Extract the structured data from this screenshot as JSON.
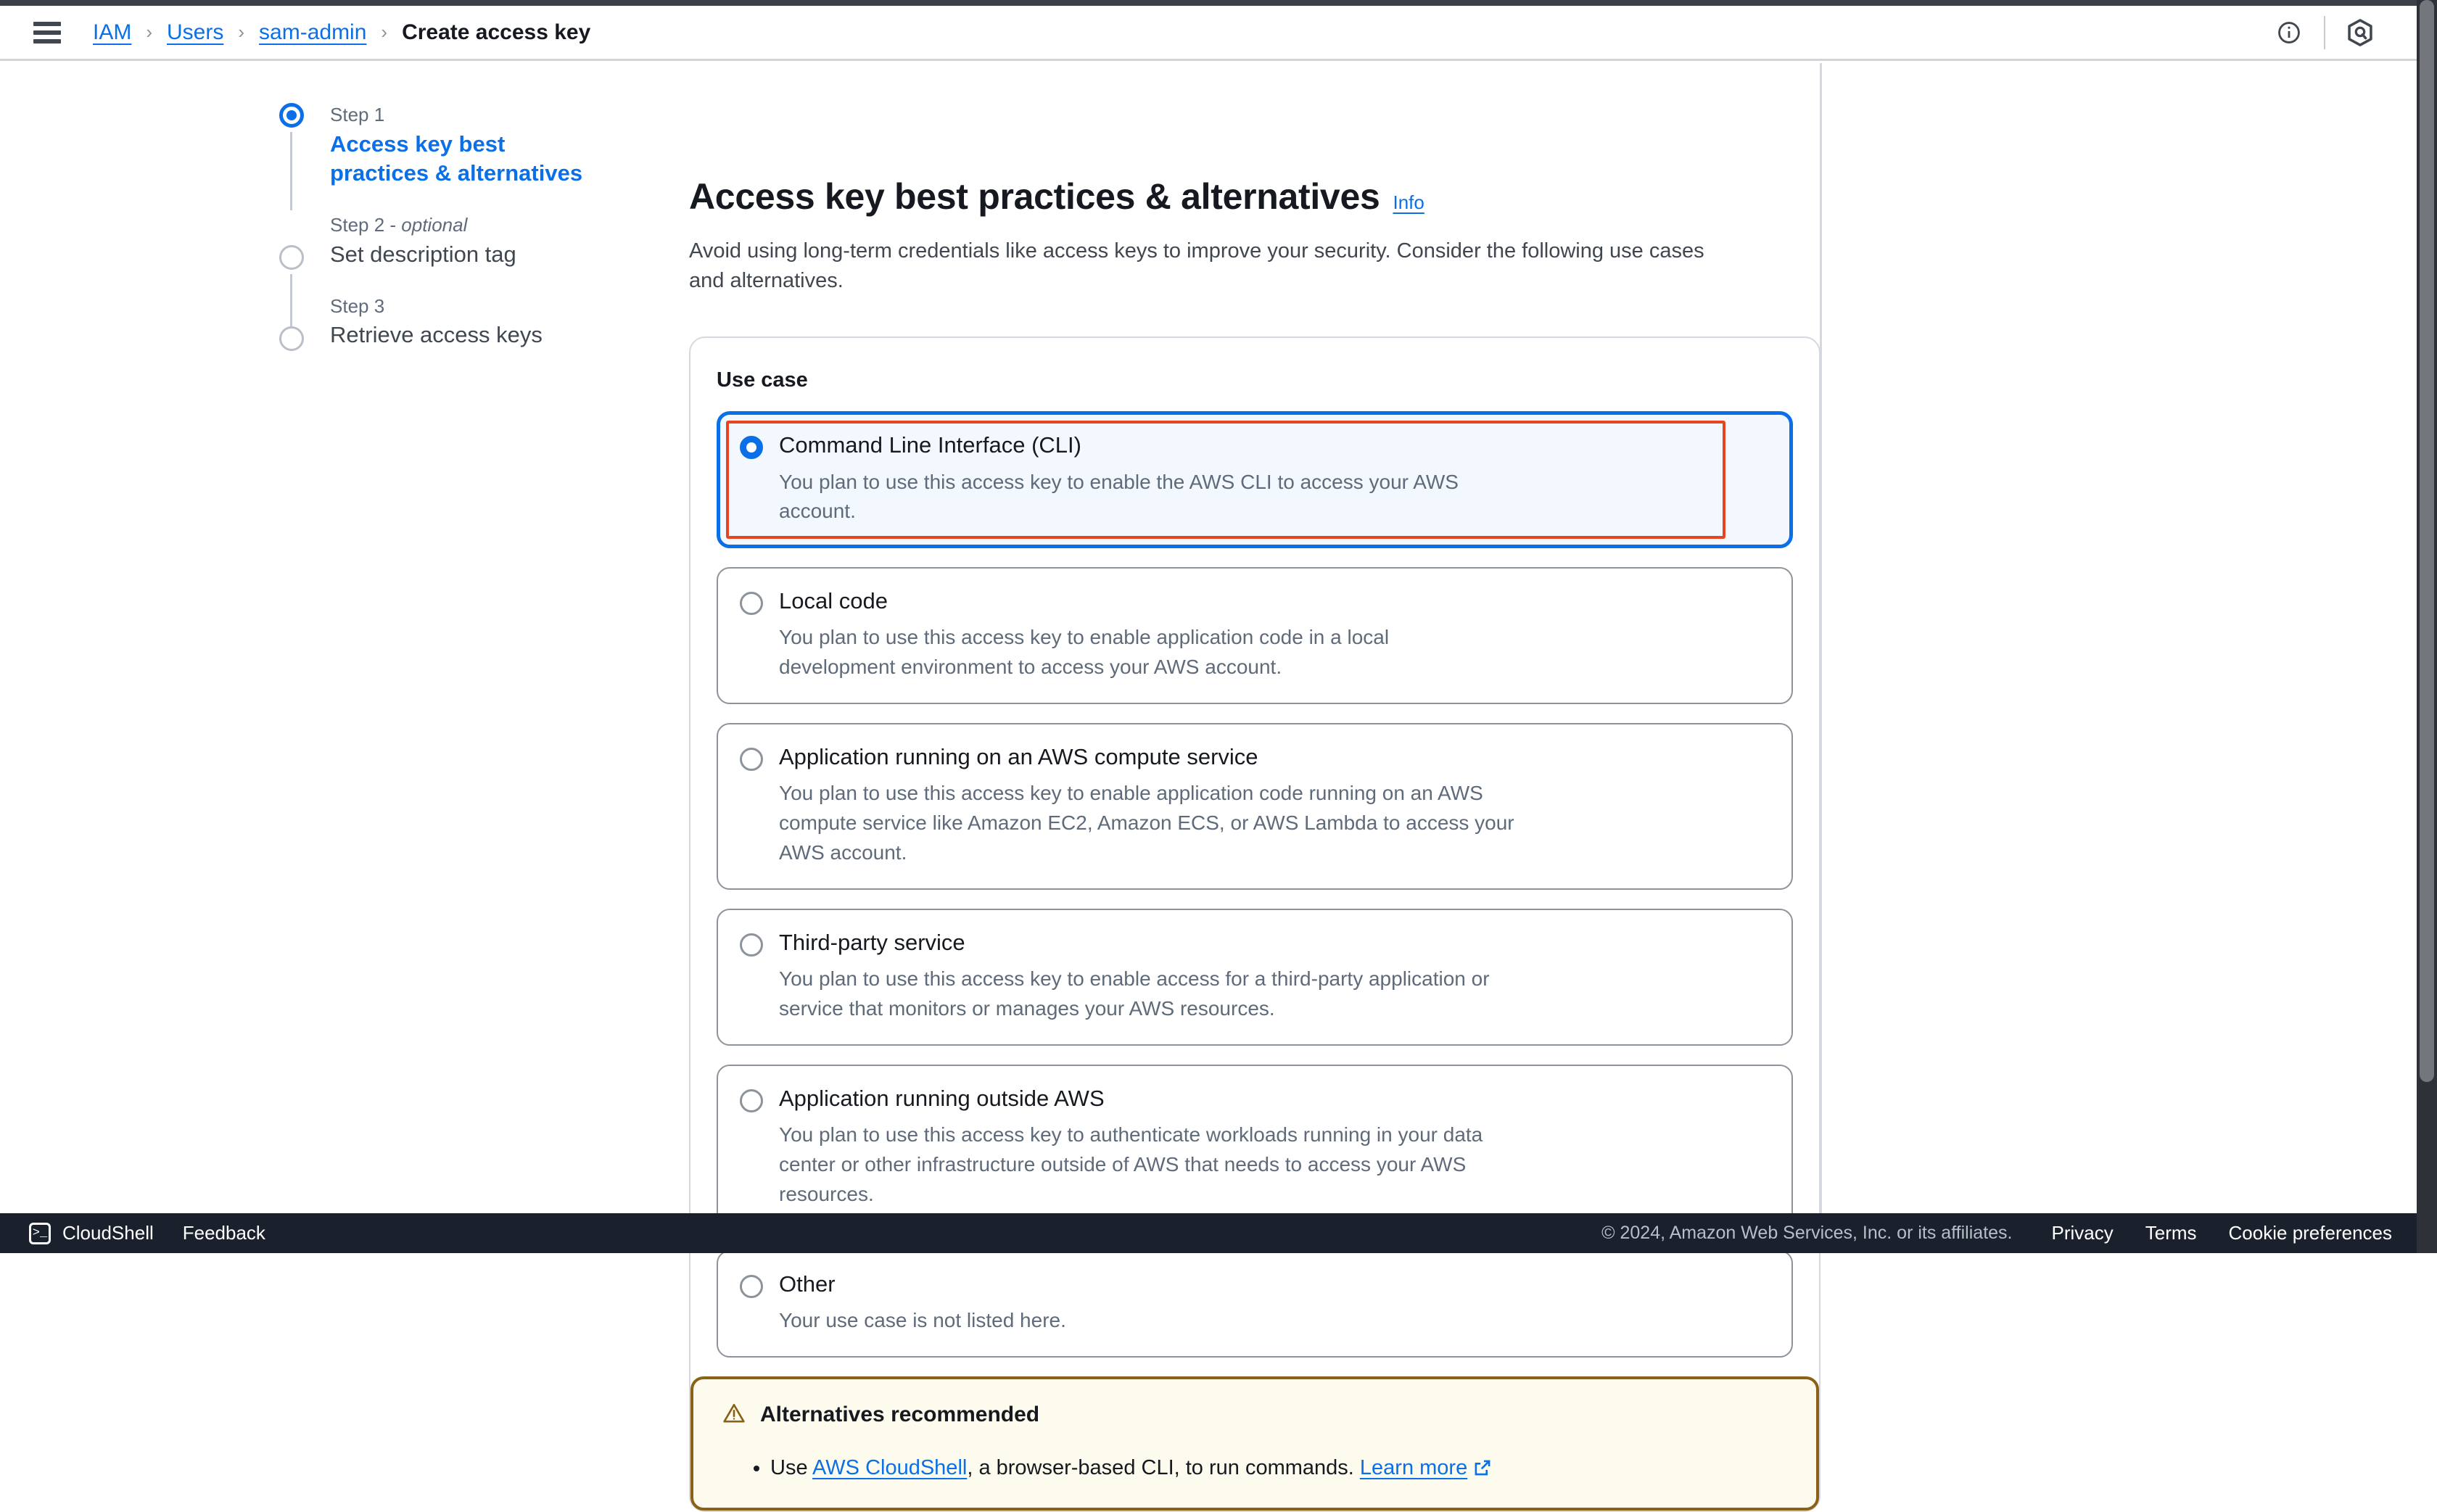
{
  "topbar": {
    "menu_icon": "hamburger-icon",
    "breadcrumb": [
      {
        "label": "IAM",
        "type": "link"
      },
      {
        "label": "Users",
        "type": "link"
      },
      {
        "label": "sam-admin",
        "type": "link"
      },
      {
        "label": "Create access key",
        "type": "current"
      }
    ],
    "separator": "›",
    "info_icon": "info-circle-icon",
    "assistant_icon": "aws-q-hexagon-icon"
  },
  "stepper": {
    "steps": [
      {
        "kicker": "Step 1",
        "kicker_em": "",
        "title": "Access key best practices & alternatives",
        "state": "active"
      },
      {
        "kicker": "Step 2 - ",
        "kicker_em": "optional",
        "title": "Set description tag",
        "state": "inactive"
      },
      {
        "kicker": "Step 3",
        "kicker_em": "",
        "title": "Retrieve access keys",
        "state": "inactive"
      }
    ]
  },
  "main": {
    "title": "Access key best practices & alternatives",
    "info_label": "Info",
    "description": "Avoid using long-term credentials like access keys to improve your security. Consider the following use cases and alternatives.",
    "section_label": "Use case",
    "options": [
      {
        "label": "Command Line Interface (CLI)",
        "description": "You plan to use this access key to enable the AWS CLI to access your AWS account.",
        "selected": true,
        "annotated": true
      },
      {
        "label": "Local code",
        "description": "You plan to use this access key to enable application code in a local development environment to access your AWS account.",
        "selected": false,
        "annotated": false
      },
      {
        "label": "Application running on an AWS compute service",
        "description": "You plan to use this access key to enable application code running on an AWS compute service like Amazon EC2, Amazon ECS, or AWS Lambda to access your AWS account.",
        "selected": false,
        "annotated": false
      },
      {
        "label": "Third-party service",
        "description": "You plan to use this access key to enable access for a third-party application or service that monitors or manages your AWS resources.",
        "selected": false,
        "annotated": false
      },
      {
        "label": "Application running outside AWS",
        "description": "You plan to use this access key to authenticate workloads running in your data center or other infrastructure outside of AWS that needs to access your AWS resources.",
        "selected": false,
        "annotated": false
      },
      {
        "label": "Other",
        "description": "Your use case is not listed here.",
        "selected": false,
        "annotated": false
      }
    ],
    "alert": {
      "icon": "warning-triangle-icon",
      "title": "Alternatives recommended",
      "bullet_prefix": "Use ",
      "bullet_link": "AWS CloudShell",
      "bullet_middle": ", a browser-based CLI, to run commands. ",
      "bullet_learn_more": "Learn more",
      "external_icon": "external-link-icon"
    }
  },
  "footer": {
    "cloudshell_icon": "cloudshell-terminal-icon",
    "cloudshell_label": "CloudShell",
    "feedback_label": "Feedback",
    "copyright": "© 2024, Amazon Web Services, Inc. or its affiliates.",
    "links": [
      "Privacy",
      "Terms",
      "Cookie preferences"
    ]
  },
  "colors": {
    "accent_blue": "#0b6fe8",
    "annotation_red": "#e8441f",
    "warning_border": "#8a6116",
    "warning_bg": "#fcfbed",
    "footer_bg": "#1b212c"
  }
}
